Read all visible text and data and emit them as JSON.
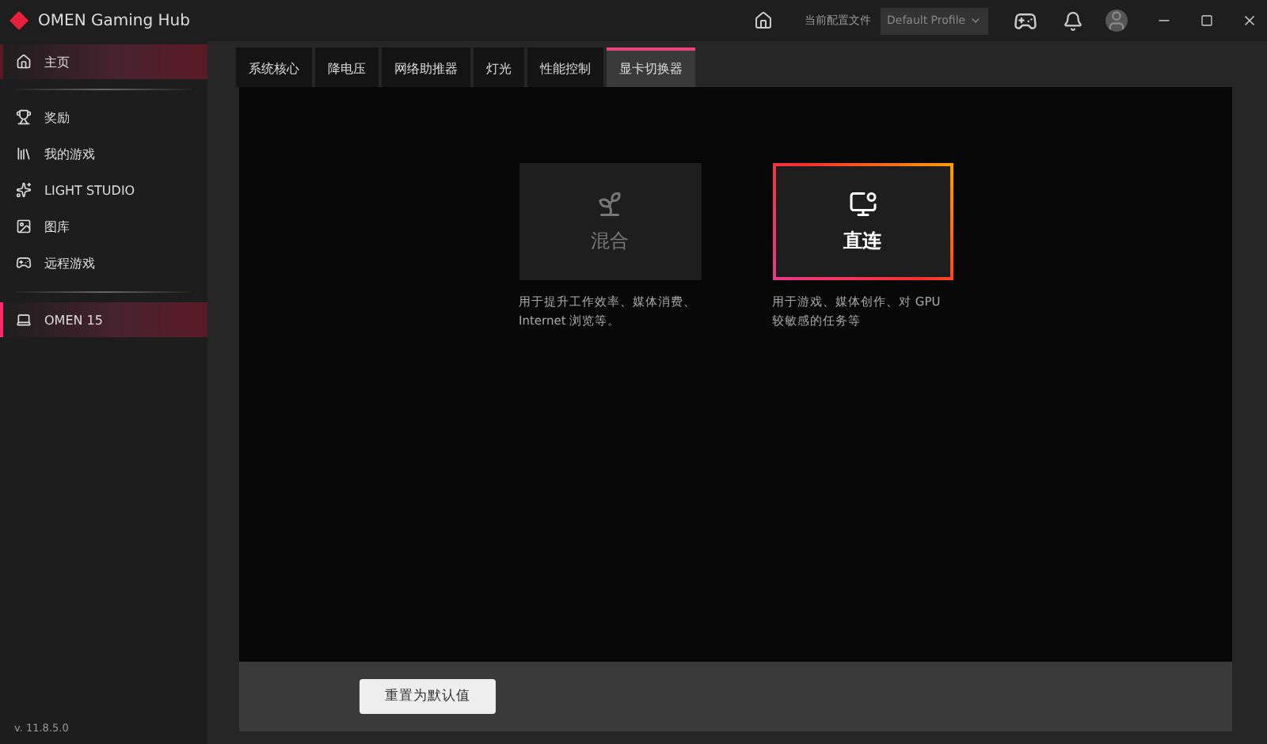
{
  "window": {
    "title": "OMEN Gaming Hub"
  },
  "header": {
    "profile_label": "当前配置文件",
    "profile_value": "Default Profile"
  },
  "sidebar": {
    "items": [
      {
        "label": "主页",
        "selected": true
      },
      {
        "label": "奖励",
        "selected": false
      },
      {
        "label": "我的游戏",
        "selected": false
      },
      {
        "label": "LIGHT STUDIO",
        "selected": false
      },
      {
        "label": "图库",
        "selected": false
      },
      {
        "label": "远程游戏",
        "selected": false
      }
    ],
    "devices": [
      {
        "label": "OMEN 15",
        "selected": true
      }
    ],
    "version": "v. 11.8.5.0"
  },
  "tabs": [
    {
      "label": "系统核心",
      "selected": false
    },
    {
      "label": "降电压",
      "selected": false
    },
    {
      "label": "网络助推器",
      "selected": false
    },
    {
      "label": "灯光",
      "selected": false
    },
    {
      "label": "性能控制",
      "selected": false
    },
    {
      "label": "显卡切换器",
      "selected": true
    }
  ],
  "modes": [
    {
      "label": "混合",
      "selected": false,
      "description": "用于提升工作效率、媒体消费、Internet 浏览等。"
    },
    {
      "label": "直连",
      "selected": true,
      "description": "用于游戏、媒体创作、对 GPU 较敏感的任务等"
    }
  ],
  "reset_button": "重置为默认值"
}
